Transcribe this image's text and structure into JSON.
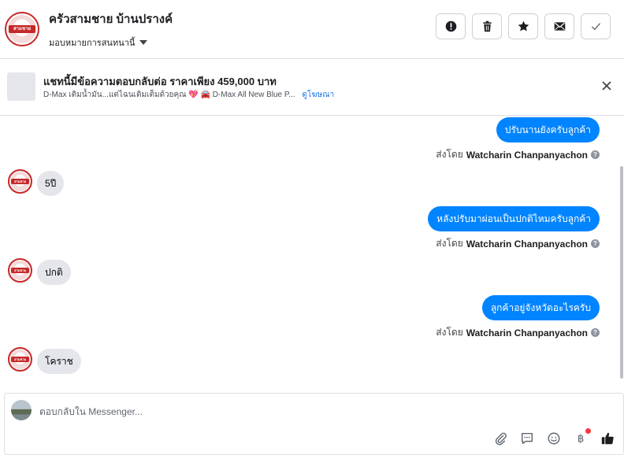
{
  "header": {
    "page_name": "ครัวสามชาย บ้านปรางค์",
    "assign_label": "มอบหมายการสนทนานี้",
    "logo_text": "สามชาย",
    "actions": [
      "spam-icon",
      "trash-icon",
      "star-icon",
      "mail-icon",
      "check-icon"
    ]
  },
  "ad": {
    "title": "แชทนี้มีข้อความตอบกลับต่อ ราคาเพียง 459,000 บาท",
    "subtitle": "D-Max เติมน้ำมัน...แต่ไฉนเติมเต็มด้วยคุณ 💖 🚘 D-Max All New Blue P...",
    "link": "ดูโฆษณา"
  },
  "messages": [
    {
      "dir": "out",
      "text": "ปรับนานยังครับลูกค้า",
      "sent_by_label": "ส่งโดย",
      "sender": "Watcharin Chanpanyachon"
    },
    {
      "dir": "in",
      "text": "5ปี"
    },
    {
      "dir": "out",
      "text": "หลังปรับมาผ่อนเป็นปกติไหมครับลูกค้า",
      "sent_by_label": "ส่งโดย",
      "sender": "Watcharin Chanpanyachon"
    },
    {
      "dir": "in",
      "text": "ปกติ"
    },
    {
      "dir": "out",
      "text": "ลูกค้าอยู่จังหวัดอะไรครับ",
      "sent_by_label": "ส่งโดย",
      "sender": "Watcharin Chanpanyachon"
    },
    {
      "dir": "in",
      "text": "โคราช"
    }
  ],
  "composer": {
    "placeholder": "ตอบกลับใน Messenger...",
    "tools": [
      "attachment-icon",
      "saved-replies-icon",
      "emoji-icon",
      "payment-icon",
      "like-icon"
    ]
  },
  "colors": {
    "outgoing": "#0084ff",
    "incoming": "#e4e6eb",
    "brand_red": "#c62828"
  }
}
